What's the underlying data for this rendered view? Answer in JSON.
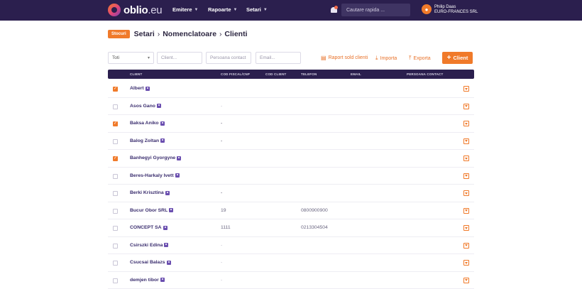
{
  "header": {
    "logo_main": "oblio",
    "logo_tld": ".eu",
    "nav": [
      {
        "label": "Emitere"
      },
      {
        "label": "Rapoarte"
      },
      {
        "label": "Setari"
      }
    ],
    "search_placeholder": "Cautare rapida ...",
    "user": {
      "name": "Philip Daas",
      "company": "EURO-FRANCES SRL"
    }
  },
  "breadcrumb": {
    "badge": "Stocuri",
    "items": [
      "Setari",
      "Nomenclatoare",
      "Clienti"
    ],
    "separator": "›"
  },
  "filters": {
    "type_value": "Toti",
    "client_placeholder": "Client...",
    "contact_placeholder": "Persoana contact",
    "email_placeholder": "Email..."
  },
  "actions": {
    "report": "Raport sold clienti",
    "import": "Importa",
    "export": "Exporta",
    "add": "Client"
  },
  "table": {
    "columns": [
      "CLIENT",
      "COD FISCAL/CNP",
      "COD CLIENT",
      "TELEFON",
      "EMAIL",
      "PERSOANA CONTACT"
    ],
    "rows": [
      {
        "name": "Albert",
        "checked": true,
        "cif": "",
        "phone": ""
      },
      {
        "name": "Asos Gano",
        "checked": false,
        "cif": "-",
        "phone": "",
        "light": true
      },
      {
        "name": "Baksa Aniko",
        "checked": true,
        "cif": "-",
        "phone": ""
      },
      {
        "name": "Balog Zoltan",
        "checked": false,
        "cif": "-",
        "phone": ""
      },
      {
        "name": "Banhegyi Gyorgyne",
        "checked": true,
        "cif": "",
        "phone": ""
      },
      {
        "name": "Beres-Harkaly Ivett",
        "checked": false,
        "cif": "",
        "phone": ""
      },
      {
        "name": "Berki Krisztina",
        "checked": false,
        "cif": "-",
        "phone": ""
      },
      {
        "name": "Bucur Obor SRL",
        "checked": false,
        "cif": "19",
        "phone": "0800900900"
      },
      {
        "name": "CONCEPT SA",
        "checked": false,
        "cif": "1111",
        "phone": "0213304504"
      },
      {
        "name": "Csirszki Edina",
        "checked": false,
        "cif": "-",
        "phone": "",
        "light": true
      },
      {
        "name": "Csucsai Balazs",
        "checked": false,
        "cif": "-",
        "phone": "",
        "light": true
      },
      {
        "name": "demjen tibor",
        "checked": false,
        "cif": "-",
        "phone": "",
        "light": true
      }
    ]
  }
}
